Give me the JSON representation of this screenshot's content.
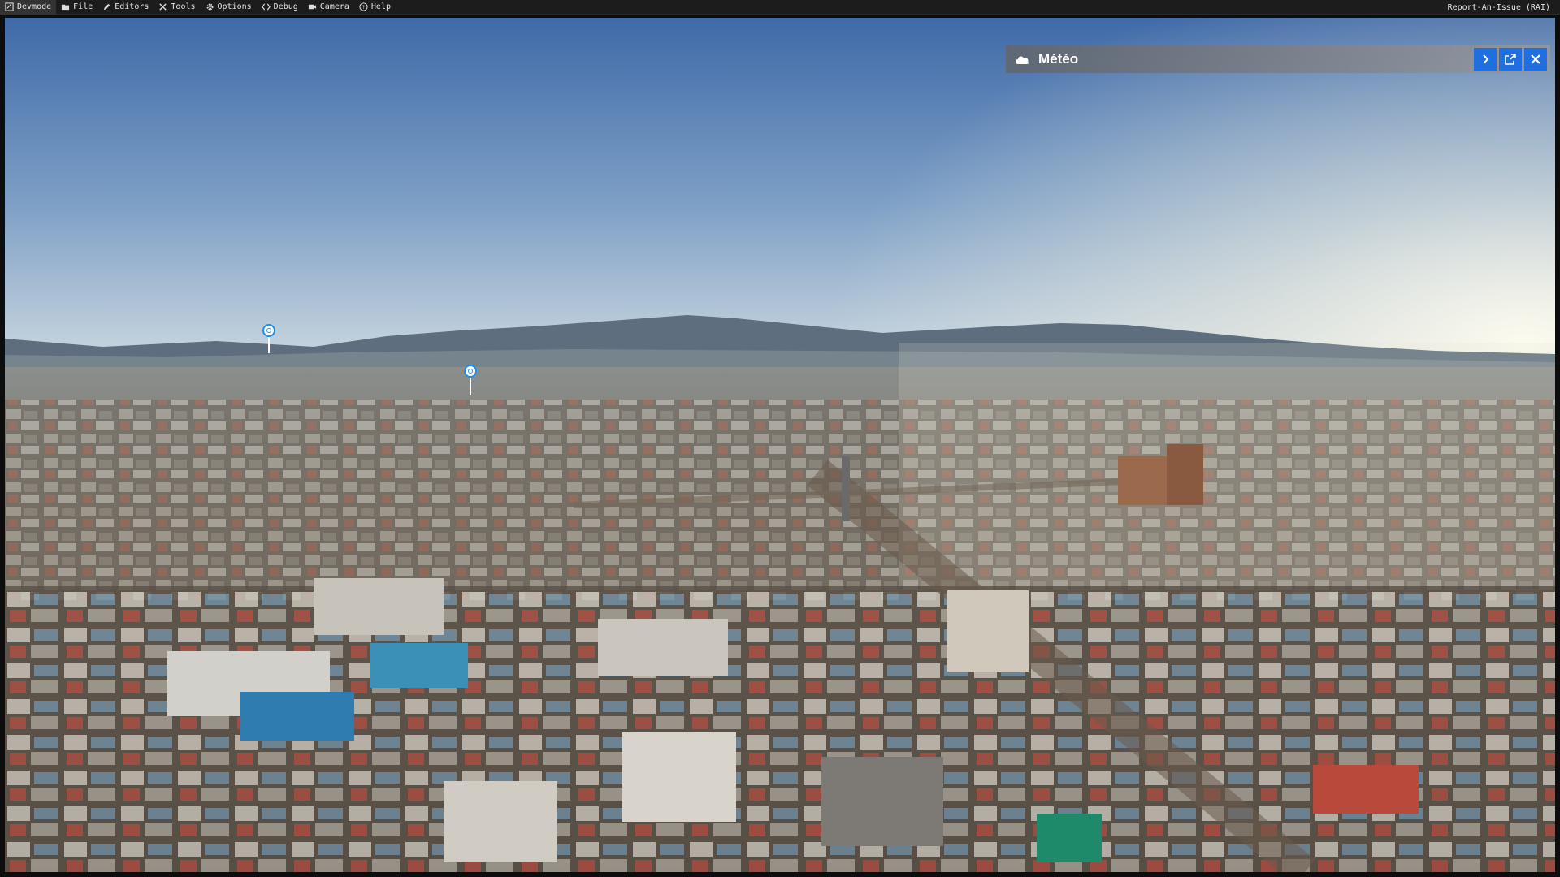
{
  "menubar": {
    "items": [
      {
        "label": "Devmode",
        "icon": "devmode-icon"
      },
      {
        "label": "File",
        "icon": "folder-icon"
      },
      {
        "label": "Editors",
        "icon": "pencil-icon"
      },
      {
        "label": "Tools",
        "icon": "tools-icon"
      },
      {
        "label": "Options",
        "icon": "gear-icon"
      },
      {
        "label": "Debug",
        "icon": "code-icon"
      },
      {
        "label": "Camera",
        "icon": "camera-icon"
      },
      {
        "label": "Help",
        "icon": "help-icon"
      }
    ],
    "report_label": "Report-An-Issue (RAI)"
  },
  "meteo_panel": {
    "title": "Météo",
    "icon": "cloud-icon",
    "buttons": [
      "expand-icon",
      "popout-icon",
      "close-icon"
    ],
    "accent": "#1f6fe0"
  },
  "viewport": {
    "scene": "aerial-city-view",
    "poi_markers": 2
  }
}
